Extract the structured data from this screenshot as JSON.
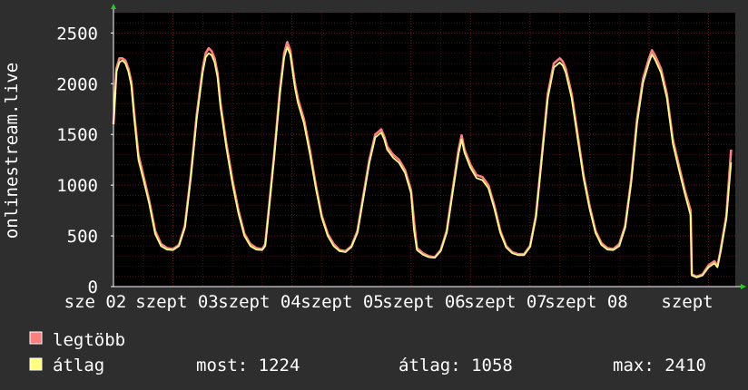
{
  "chart_data": {
    "type": "line",
    "ylabel": "onlinestream.live",
    "ylim": [
      0,
      2700
    ],
    "y_ticks": [
      0,
      500,
      1000,
      1500,
      2000,
      2500
    ],
    "x_tick_labels": [
      "sze 02",
      "szept 03",
      "szept 04",
      "szept 05",
      "szept 06",
      "szept 07",
      "szept 08",
      "szept"
    ],
    "grid": true,
    "background": "#000000",
    "grid_color": "#6b1b1b",
    "axis_color": "#ffffff",
    "series": [
      {
        "name": "legtöbb",
        "color": "#ff7f7f",
        "points": [
          [
            0,
            1600
          ],
          [
            0.05,
            2150
          ],
          [
            0.1,
            2250
          ],
          [
            0.15,
            2250
          ],
          [
            0.2,
            2230
          ],
          [
            0.25,
            2150
          ],
          [
            0.3,
            2020
          ],
          [
            0.35,
            1700
          ],
          [
            0.42,
            1300
          ],
          [
            0.5,
            1100
          ],
          [
            0.6,
            850
          ],
          [
            0.7,
            550
          ],
          [
            0.8,
            420
          ],
          [
            0.9,
            380
          ],
          [
            1.0,
            370
          ],
          [
            1.1,
            410
          ],
          [
            1.2,
            600
          ],
          [
            1.3,
            1100
          ],
          [
            1.4,
            1700
          ],
          [
            1.5,
            2150
          ],
          [
            1.55,
            2300
          ],
          [
            1.6,
            2350
          ],
          [
            1.65,
            2320
          ],
          [
            1.7,
            2250
          ],
          [
            1.75,
            2100
          ],
          [
            1.8,
            1800
          ],
          [
            1.9,
            1400
          ],
          [
            2.0,
            1050
          ],
          [
            2.1,
            750
          ],
          [
            2.2,
            520
          ],
          [
            2.3,
            420
          ],
          [
            2.4,
            380
          ],
          [
            2.5,
            370
          ],
          [
            2.55,
            420
          ],
          [
            2.6,
            700
          ],
          [
            2.7,
            1300
          ],
          [
            2.8,
            1950
          ],
          [
            2.87,
            2300
          ],
          [
            2.92,
            2410
          ],
          [
            2.97,
            2330
          ],
          [
            3.0,
            2200
          ],
          [
            3.05,
            2000
          ],
          [
            3.1,
            1850
          ],
          [
            3.2,
            1650
          ],
          [
            3.3,
            1350
          ],
          [
            3.4,
            1000
          ],
          [
            3.5,
            700
          ],
          [
            3.6,
            520
          ],
          [
            3.7,
            420
          ],
          [
            3.8,
            360
          ],
          [
            3.9,
            350
          ],
          [
            4.0,
            400
          ],
          [
            4.1,
            550
          ],
          [
            4.2,
            900
          ],
          [
            4.3,
            1250
          ],
          [
            4.4,
            1500
          ],
          [
            4.5,
            1550
          ],
          [
            4.55,
            1480
          ],
          [
            4.6,
            1380
          ],
          [
            4.7,
            1300
          ],
          [
            4.8,
            1250
          ],
          [
            4.9,
            1150
          ],
          [
            5.0,
            950
          ],
          [
            5.05,
            650
          ],
          [
            5.1,
            380
          ],
          [
            5.2,
            330
          ],
          [
            5.3,
            300
          ],
          [
            5.4,
            290
          ],
          [
            5.5,
            360
          ],
          [
            5.6,
            550
          ],
          [
            5.7,
            950
          ],
          [
            5.8,
            1350
          ],
          [
            5.85,
            1490
          ],
          [
            5.9,
            1350
          ],
          [
            6.0,
            1200
          ],
          [
            6.1,
            1100
          ],
          [
            6.2,
            1080
          ],
          [
            6.3,
            1000
          ],
          [
            6.4,
            800
          ],
          [
            6.5,
            550
          ],
          [
            6.6,
            400
          ],
          [
            6.7,
            340
          ],
          [
            6.8,
            320
          ],
          [
            6.9,
            320
          ],
          [
            7.0,
            400
          ],
          [
            7.1,
            700
          ],
          [
            7.2,
            1300
          ],
          [
            7.3,
            1900
          ],
          [
            7.4,
            2200
          ],
          [
            7.5,
            2250
          ],
          [
            7.55,
            2220
          ],
          [
            7.6,
            2150
          ],
          [
            7.7,
            1900
          ],
          [
            7.8,
            1500
          ],
          [
            7.9,
            1100
          ],
          [
            8.0,
            800
          ],
          [
            8.1,
            550
          ],
          [
            8.2,
            430
          ],
          [
            8.3,
            380
          ],
          [
            8.4,
            370
          ],
          [
            8.5,
            420
          ],
          [
            8.6,
            600
          ],
          [
            8.7,
            1050
          ],
          [
            8.8,
            1650
          ],
          [
            8.9,
            2050
          ],
          [
            9.0,
            2250
          ],
          [
            9.05,
            2330
          ],
          [
            9.1,
            2280
          ],
          [
            9.2,
            2150
          ],
          [
            9.3,
            1900
          ],
          [
            9.4,
            1450
          ],
          [
            9.5,
            1200
          ],
          [
            9.6,
            950
          ],
          [
            9.7,
            750
          ],
          [
            9.72,
            120
          ],
          [
            9.8,
            100
          ],
          [
            9.9,
            120
          ],
          [
            10.0,
            210
          ],
          [
            10.1,
            250
          ],
          [
            10.15,
            200
          ],
          [
            10.2,
            350
          ],
          [
            10.3,
            700
          ],
          [
            10.38,
            1350
          ]
        ]
      },
      {
        "name": "átlag",
        "color": "#ffff80",
        "points": [
          [
            0,
            1600
          ],
          [
            0.05,
            2120
          ],
          [
            0.1,
            2210
          ],
          [
            0.15,
            2230
          ],
          [
            0.2,
            2200
          ],
          [
            0.25,
            2120
          ],
          [
            0.3,
            1980
          ],
          [
            0.35,
            1650
          ],
          [
            0.42,
            1250
          ],
          [
            0.5,
            1060
          ],
          [
            0.6,
            820
          ],
          [
            0.7,
            520
          ],
          [
            0.8,
            400
          ],
          [
            0.9,
            365
          ],
          [
            1.0,
            360
          ],
          [
            1.1,
            400
          ],
          [
            1.2,
            580
          ],
          [
            1.3,
            1070
          ],
          [
            1.4,
            1660
          ],
          [
            1.5,
            2110
          ],
          [
            1.55,
            2260
          ],
          [
            1.6,
            2300
          ],
          [
            1.65,
            2280
          ],
          [
            1.7,
            2210
          ],
          [
            1.75,
            2060
          ],
          [
            1.8,
            1760
          ],
          [
            1.9,
            1360
          ],
          [
            2.0,
            1010
          ],
          [
            2.1,
            720
          ],
          [
            2.2,
            500
          ],
          [
            2.3,
            400
          ],
          [
            2.4,
            365
          ],
          [
            2.5,
            360
          ],
          [
            2.55,
            400
          ],
          [
            2.6,
            680
          ],
          [
            2.7,
            1270
          ],
          [
            2.8,
            1910
          ],
          [
            2.87,
            2260
          ],
          [
            2.92,
            2360
          ],
          [
            2.97,
            2290
          ],
          [
            3.0,
            2160
          ],
          [
            3.05,
            1960
          ],
          [
            3.1,
            1810
          ],
          [
            3.2,
            1610
          ],
          [
            3.3,
            1310
          ],
          [
            3.4,
            970
          ],
          [
            3.5,
            680
          ],
          [
            3.6,
            500
          ],
          [
            3.7,
            400
          ],
          [
            3.8,
            350
          ],
          [
            3.9,
            340
          ],
          [
            4.0,
            390
          ],
          [
            4.1,
            530
          ],
          [
            4.2,
            870
          ],
          [
            4.3,
            1220
          ],
          [
            4.4,
            1470
          ],
          [
            4.5,
            1520
          ],
          [
            4.55,
            1450
          ],
          [
            4.6,
            1350
          ],
          [
            4.7,
            1270
          ],
          [
            4.8,
            1220
          ],
          [
            4.9,
            1120
          ],
          [
            5.0,
            920
          ],
          [
            5.05,
            560
          ],
          [
            5.1,
            360
          ],
          [
            5.2,
            315
          ],
          [
            5.3,
            290
          ],
          [
            5.4,
            285
          ],
          [
            5.5,
            350
          ],
          [
            5.6,
            530
          ],
          [
            5.7,
            920
          ],
          [
            5.8,
            1310
          ],
          [
            5.85,
            1450
          ],
          [
            5.9,
            1320
          ],
          [
            6.0,
            1170
          ],
          [
            6.1,
            1070
          ],
          [
            6.2,
            1050
          ],
          [
            6.3,
            970
          ],
          [
            6.4,
            770
          ],
          [
            6.5,
            530
          ],
          [
            6.6,
            385
          ],
          [
            6.7,
            330
          ],
          [
            6.8,
            310
          ],
          [
            6.9,
            310
          ],
          [
            7.0,
            390
          ],
          [
            7.1,
            680
          ],
          [
            7.2,
            1270
          ],
          [
            7.3,
            1860
          ],
          [
            7.4,
            2160
          ],
          [
            7.5,
            2210
          ],
          [
            7.55,
            2180
          ],
          [
            7.6,
            2110
          ],
          [
            7.7,
            1860
          ],
          [
            7.8,
            1460
          ],
          [
            7.9,
            1070
          ],
          [
            8.0,
            770
          ],
          [
            8.1,
            530
          ],
          [
            8.2,
            410
          ],
          [
            8.3,
            365
          ],
          [
            8.4,
            360
          ],
          [
            8.5,
            400
          ],
          [
            8.6,
            580
          ],
          [
            8.7,
            1020
          ],
          [
            8.8,
            1610
          ],
          [
            8.9,
            2010
          ],
          [
            9.0,
            2210
          ],
          [
            9.05,
            2290
          ],
          [
            9.1,
            2240
          ],
          [
            9.2,
            2110
          ],
          [
            9.3,
            1860
          ],
          [
            9.4,
            1410
          ],
          [
            9.5,
            1160
          ],
          [
            9.6,
            920
          ],
          [
            9.7,
            700
          ],
          [
            9.72,
            110
          ],
          [
            9.8,
            90
          ],
          [
            9.9,
            110
          ],
          [
            10.0,
            190
          ],
          [
            10.1,
            230
          ],
          [
            10.15,
            190
          ],
          [
            10.2,
            330
          ],
          [
            10.3,
            670
          ],
          [
            10.38,
            1224
          ]
        ]
      }
    ],
    "x_range": [
      0,
      10.45
    ]
  },
  "legend": [
    {
      "label": "legtöbb",
      "color": "#ff7f7f"
    },
    {
      "label": "átlag",
      "color": "#ffff80"
    }
  ],
  "stats": {
    "now": "most: 1224",
    "avg": "átlag: 1058",
    "max": "max: 2410"
  }
}
